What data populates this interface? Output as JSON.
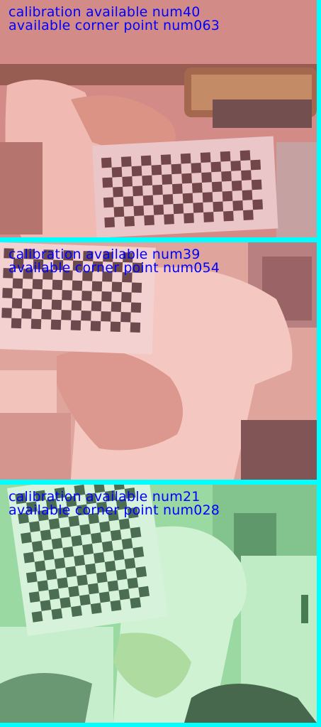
{
  "panels": [
    {
      "tint": "#f08f8a",
      "line1": "calibration available num40",
      "line2": "available corner point num063"
    },
    {
      "tint": "#f3a69b",
      "line1": "calibration available num39",
      "line2": "available corner point num054"
    },
    {
      "tint": "#8ee59c",
      "line1": "calibration available num21",
      "line2": "available corner point num028"
    }
  ],
  "colors": {
    "separator": "#00ffff",
    "overlay_text": "#0000ff"
  }
}
